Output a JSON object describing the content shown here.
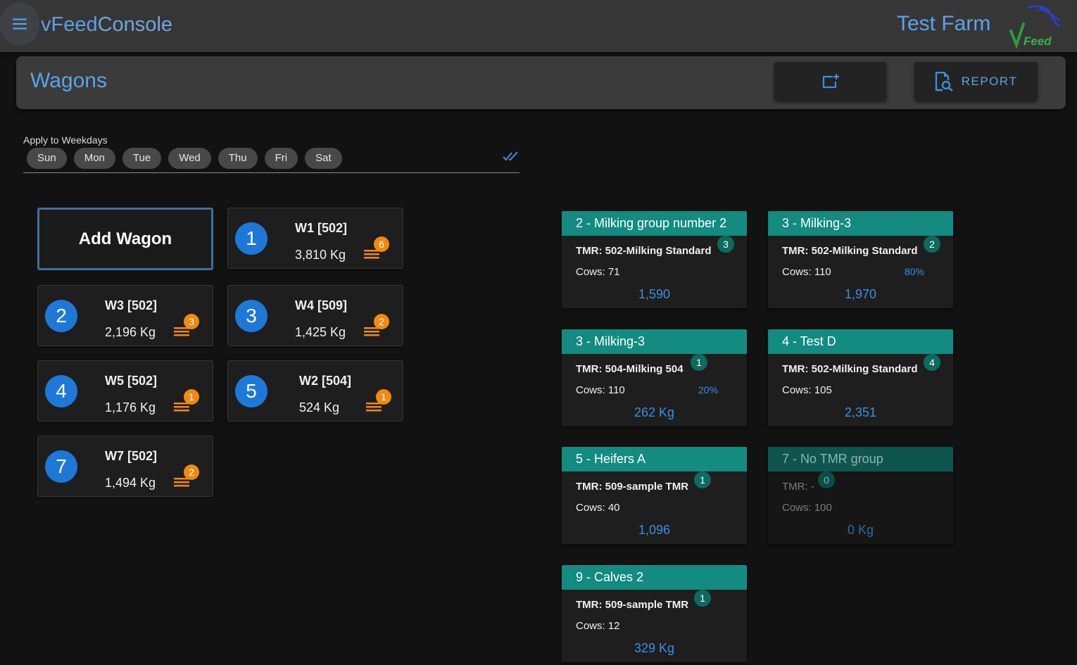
{
  "app": {
    "title_part1": "vFeed",
    "title_part2": "Console",
    "farm_name": "Test Farm",
    "logo_text": "Feed"
  },
  "page": {
    "title": "Wagons",
    "report_label": "REPORT"
  },
  "weekdays": {
    "label": "Apply to Weekdays",
    "days": [
      "Sun",
      "Mon",
      "Tue",
      "Wed",
      "Thu",
      "Fri",
      "Sat"
    ]
  },
  "wagons": {
    "add_label": "Add Wagon",
    "items": [
      {
        "number": "1",
        "name": "W1 [502]",
        "kg": "3,810 Kg",
        "count": "6"
      },
      {
        "number": "2",
        "name": "W3 [502]",
        "kg": "2,196 Kg",
        "count": "3"
      },
      {
        "number": "3",
        "name": "W4 [509]",
        "kg": "1,425 Kg",
        "count": "2"
      },
      {
        "number": "4",
        "name": "W5 [502]",
        "kg": "1,176 Kg",
        "count": "1"
      },
      {
        "number": "5",
        "name": "W2 [504]",
        "kg": "524 Kg",
        "count": "1"
      },
      {
        "number": "7",
        "name": "W7 [502]",
        "kg": "1,494 Kg",
        "count": "2"
      }
    ]
  },
  "groups": [
    {
      "title": "2 - Milking group number 2",
      "tmr": "TMR: 502-Milking Standard",
      "count": "3",
      "cows": "Cows: 71",
      "pct": "",
      "value": "1,590"
    },
    {
      "title": "3 - Milking-3",
      "tmr": "TMR: 502-Milking Standard",
      "count": "2",
      "cows": "Cows: 110",
      "pct": "80%",
      "value": "1,970"
    },
    {
      "title": "3 - Milking-3",
      "tmr": "TMR: 504-Milking 504",
      "count": "1",
      "cows": "Cows: 110",
      "pct": "20%",
      "value": "262 Kg"
    },
    {
      "title": "4 - Test D",
      "tmr": "TMR: 502-Milking Standard",
      "count": "4",
      "cows": "Cows: 105",
      "pct": "",
      "value": "2,351"
    },
    {
      "title": "5 - Heifers A",
      "tmr": "TMR: 509-sample TMR",
      "count": "1",
      "cows": "Cows: 40",
      "pct": "",
      "value": "1,096"
    },
    {
      "title": "7 - No TMR group",
      "tmr": "TMR: -",
      "count": "0",
      "cows": "Cows: 100",
      "pct": "",
      "value": "0 Kg"
    },
    {
      "title": "9 - Calves 2",
      "tmr": "TMR: 509-sample TMR",
      "count": "1",
      "cows": "Cows: 12",
      "pct": "",
      "value": "329 Kg"
    }
  ],
  "colors": {
    "accent_blue": "#5ba3e8",
    "wagon_number_blue": "#1e78d8",
    "badge_orange": "#f08a10",
    "group_header_teal": "#138b80"
  }
}
